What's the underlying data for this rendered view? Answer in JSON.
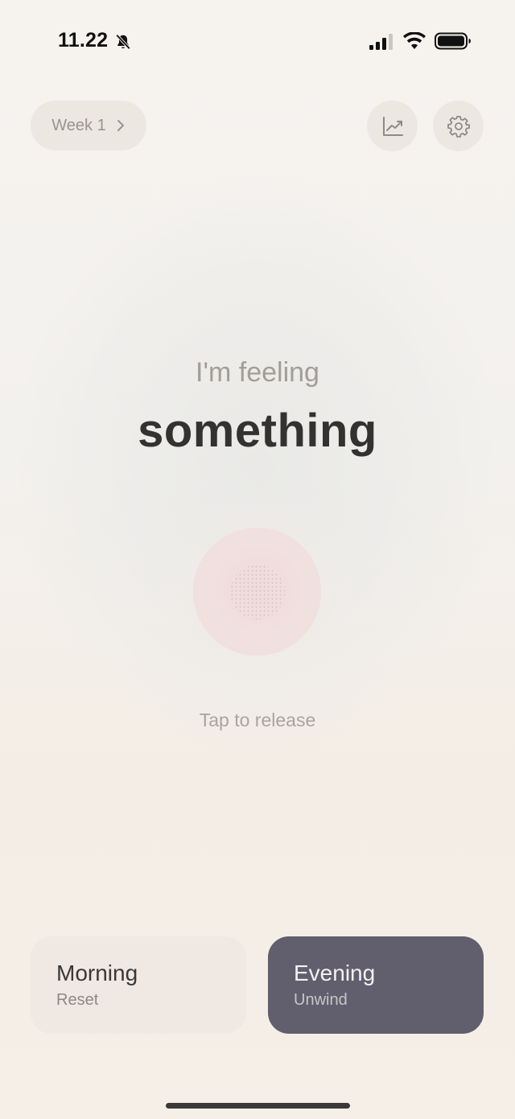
{
  "status_bar": {
    "time": "11.22",
    "icons": [
      "bell-off-icon",
      "signal-icon",
      "wifi-icon",
      "battery-icon"
    ]
  },
  "header": {
    "week_label": "Week 1",
    "week_chevron": "chevron-right-icon",
    "stats_icon": "chart-trend-icon",
    "settings_icon": "gear-icon"
  },
  "main": {
    "feeling_label": "I'm feeling",
    "feeling_value": "something",
    "tap_hint": "Tap to release"
  },
  "modes": [
    {
      "title": "Morning",
      "subtitle": "Reset",
      "selected": false
    },
    {
      "title": "Evening",
      "subtitle": "Unwind",
      "selected": true
    }
  ],
  "colors": {
    "background": "#f5f1ec",
    "pill": "#ede7e2",
    "orb": "#f0dedd",
    "selected_card": "#615e6d",
    "primary_text": "#333230",
    "muted_text": "#a29d98"
  }
}
